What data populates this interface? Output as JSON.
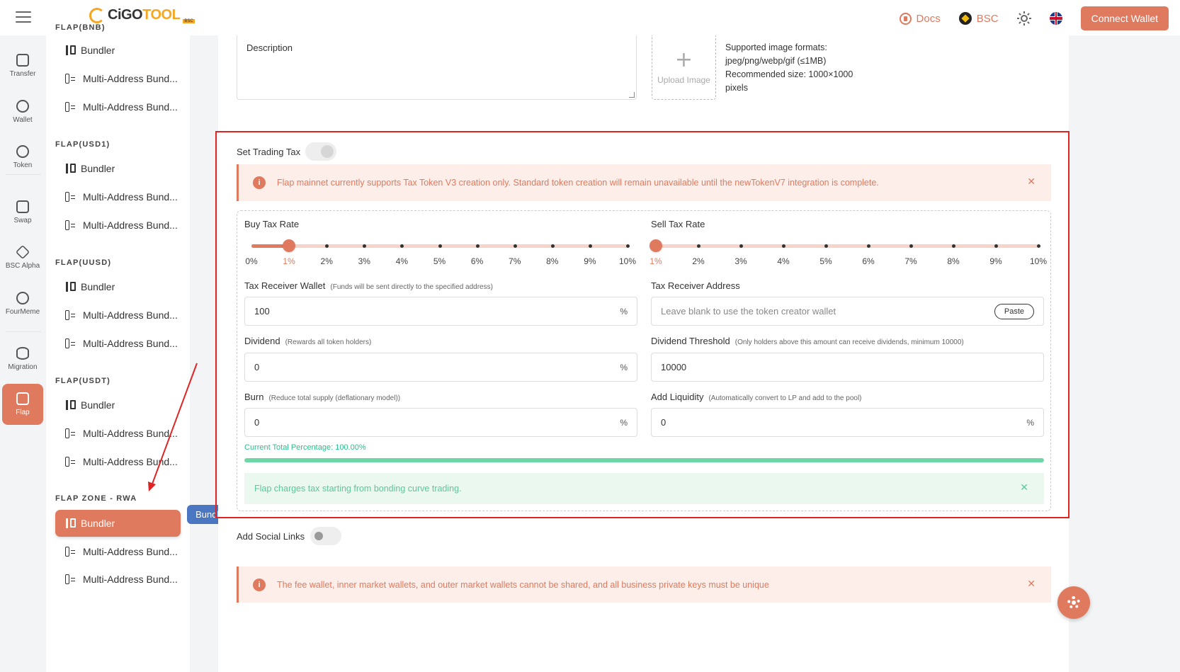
{
  "header": {
    "logo_text_a": "CiGO",
    "logo_text_b": "TOOL",
    "logo_badge": "BSC",
    "docs_label": "Docs",
    "network_label": "BSC",
    "connect_label": "Connect Wallet"
  },
  "rail": [
    {
      "label": "Transfer",
      "icon": "transfer-icon"
    },
    {
      "label": "Wallet",
      "icon": "wallet-icon"
    },
    {
      "label": "Token",
      "icon": "token-icon"
    },
    {
      "label": "Swap",
      "icon": "swap-icon"
    },
    {
      "label": "BSC Alpha",
      "icon": "bsc-alpha-icon"
    },
    {
      "label": "FourMeme",
      "icon": "fourmeme-icon"
    },
    {
      "label": "Migration",
      "icon": "migration-icon"
    },
    {
      "label": "Flap",
      "icon": "flap-icon"
    }
  ],
  "sidebar": {
    "groups": [
      {
        "heading": "FLAP(BNB)",
        "items": [
          "Bundler",
          "Multi-Address Bund...",
          "Multi-Address Bund..."
        ]
      },
      {
        "heading": "FLAP(USD1)",
        "items": [
          "Bundler",
          "Multi-Address Bund...",
          "Multi-Address Bund..."
        ]
      },
      {
        "heading": "FLAP(UUSD)",
        "items": [
          "Bundler",
          "Multi-Address Bund...",
          "Multi-Address Bund..."
        ]
      },
      {
        "heading": "FLAP(USDT)",
        "items": [
          "Bundler",
          "Multi-Address Bund...",
          "Multi-Address Bund..."
        ]
      },
      {
        "heading": "FLAP ZONE - RWA",
        "items": [
          "Bundler",
          "Multi-Address Bund...",
          "Multi-Address Bund..."
        ]
      }
    ],
    "tooltip": "Bundler"
  },
  "main": {
    "description_placeholder": "Description",
    "upload_label": "Upload Image",
    "upload_info": [
      "Supported image formats:",
      "jpeg/png/webp/gif (≤1MB)",
      "Recommended size: 1000×1000",
      "pixels"
    ],
    "set_trading_tax": "Set Trading Tax",
    "tax_alert": "Flap mainnet currently supports Tax Token V3 creation only. Standard token creation will remain unavailable until the newTokenV7 integration is complete.",
    "buy_tax_label": "Buy Tax Rate",
    "sell_tax_label": "Sell Tax Rate",
    "buy_marks": [
      "0%",
      "1%",
      "2%",
      "3%",
      "4%",
      "5%",
      "6%",
      "7%",
      "8%",
      "9%",
      "10%"
    ],
    "sell_marks": [
      "1%",
      "2%",
      "3%",
      "4%",
      "5%",
      "6%",
      "7%",
      "8%",
      "9%",
      "10%"
    ],
    "buy_tax_value": 1,
    "sell_tax_value": 1,
    "tax_receiver_wallet_label": "Tax Receiver Wallet",
    "tax_receiver_wallet_hint": "(Funds will be sent directly to the specified address)",
    "tax_receiver_wallet_value": "100",
    "percent_suffix": "%",
    "tax_receiver_address_label": "Tax Receiver Address",
    "tax_receiver_address_placeholder": "Leave blank to use the token creator wallet",
    "paste_label": "Paste",
    "dividend_label": "Dividend",
    "dividend_hint": "(Rewards all token holders)",
    "dividend_value": "0",
    "dividend_threshold_label": "Dividend Threshold",
    "dividend_threshold_hint": "(Only holders above this amount can receive dividends, minimum 10000)",
    "dividend_threshold_value": "10000",
    "burn_label": "Burn",
    "burn_hint": "(Reduce total supply (deflationary model))",
    "burn_value": "0",
    "add_liquidity_label": "Add Liquidity",
    "add_liquidity_hint": "(Automatically convert to LP and add to the pool)",
    "add_liquidity_value": "0",
    "total_percentage": "Current Total Percentage: 100.00%",
    "total_percentage_fill": 1.0,
    "bonding_note": "Flap charges tax starting from bonding curve trading.",
    "add_social_links": "Add Social Links",
    "fee_alert": "The fee wallet, inner market wallets, and outer market wallets cannot be shared, and all business private keys must be unique"
  },
  "colors": {
    "accent": "#e07a5f",
    "highlight_frame": "#e02424",
    "success": "#2bbf8a",
    "tooltip": "#4a76c2"
  }
}
